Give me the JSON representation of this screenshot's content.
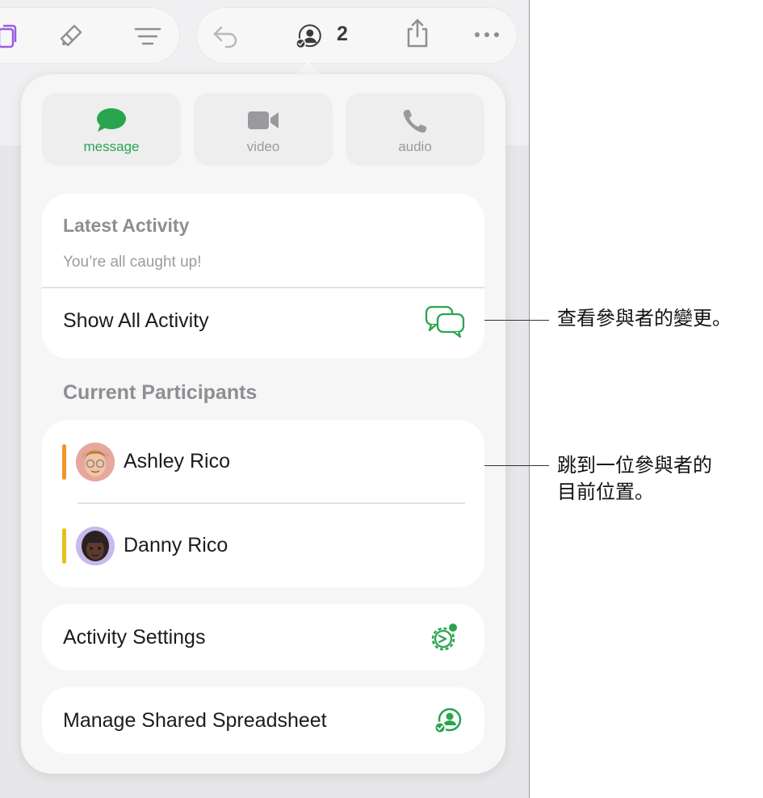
{
  "toolbar": {
    "participant_count": "2"
  },
  "communication": {
    "message_label": "message",
    "video_label": "video",
    "audio_label": "audio"
  },
  "activity": {
    "title": "Latest Activity",
    "status": "You’re all caught up!",
    "show_all_label": "Show All Activity"
  },
  "participants": {
    "header": "Current Participants",
    "list": [
      {
        "name": "Ashley Rico",
        "color": "#f39425"
      },
      {
        "name": "Danny Rico",
        "color": "#e3c21e"
      }
    ]
  },
  "settings": {
    "activity_settings_label": "Activity Settings",
    "manage_label": "Manage Shared Spreadsheet"
  },
  "callouts": {
    "activity_note": "查看參與者的變更。",
    "participant_note_line1": "跳到一位參與者的",
    "participant_note_line2": "目前位置。"
  },
  "colors": {
    "accent": "#2aa44f",
    "popover_bg": "#f6f6f7",
    "secondary_text": "#8e8e93"
  },
  "icons": {
    "toolbar": [
      "copy-icon",
      "paintbrush-icon",
      "format-icon",
      "undo-icon",
      "collaboration-icon",
      "share-icon",
      "more-icon"
    ],
    "communication": [
      "message-icon",
      "video-icon",
      "phone-icon"
    ],
    "rows": [
      "activity-chat-icon",
      "activity-settings-icon",
      "manage-share-icon"
    ]
  }
}
